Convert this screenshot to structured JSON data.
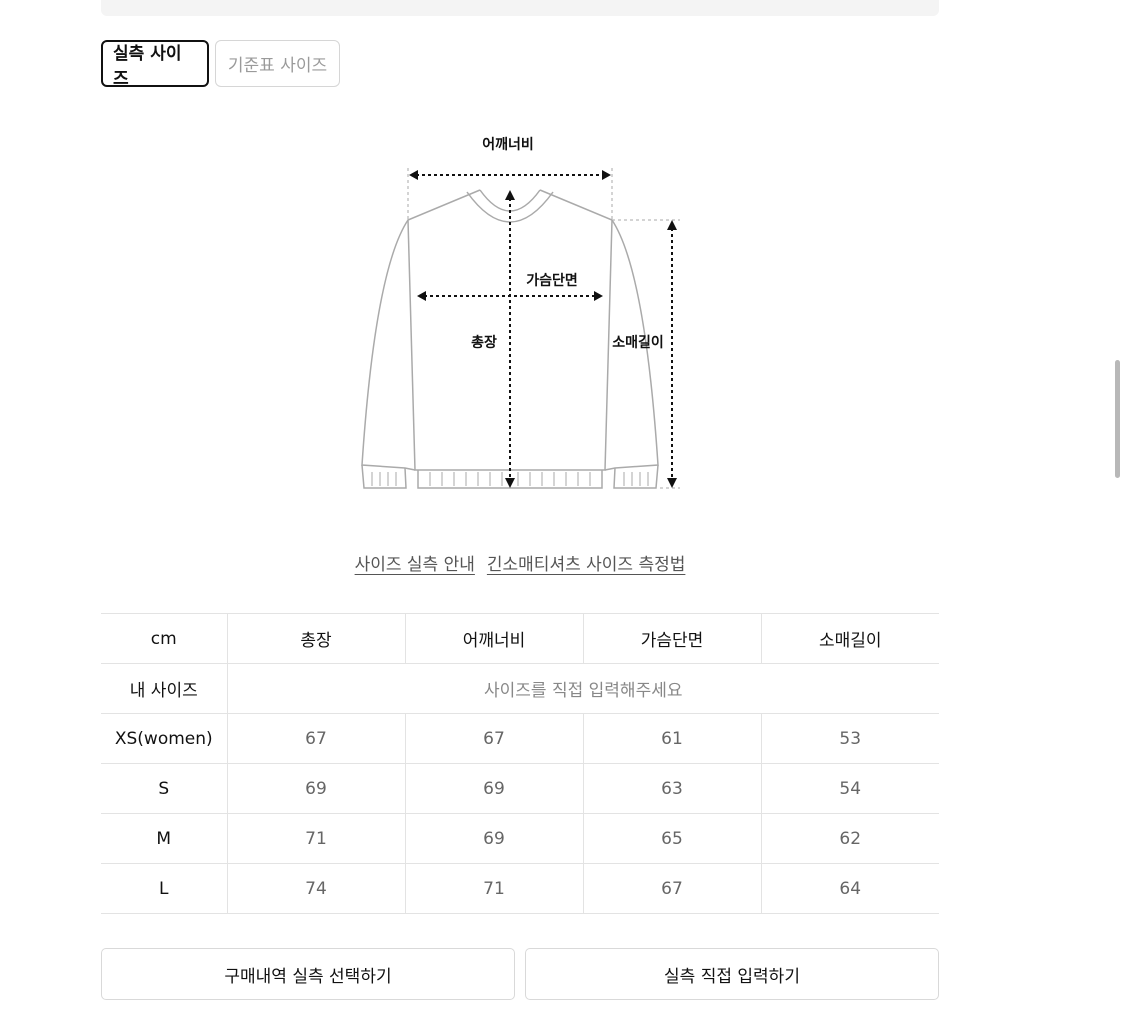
{
  "tabs": {
    "measured": "실측 사이즈",
    "standard": "기준표 사이즈"
  },
  "diagram": {
    "shoulder": "어깨너비",
    "chest": "가슴단면",
    "length": "총장",
    "sleeve": "소매길이"
  },
  "links": {
    "guide": "사이즈 실측 안내",
    "method": "긴소매티셔츠 사이즈 측정법"
  },
  "table": {
    "headers": [
      "cm",
      "총장",
      "어깨너비",
      "가슴단면",
      "소매길이"
    ],
    "my_size_label": "내 사이즈",
    "my_size_placeholder": "사이즈를 직접 입력해주세요",
    "rows": [
      {
        "size": "XS(women)",
        "values": [
          "67",
          "67",
          "61",
          "53"
        ]
      },
      {
        "size": "S",
        "values": [
          "69",
          "69",
          "63",
          "54"
        ]
      },
      {
        "size": "M",
        "values": [
          "71",
          "69",
          "65",
          "62"
        ]
      },
      {
        "size": "L",
        "values": [
          "74",
          "71",
          "67",
          "64"
        ]
      }
    ]
  },
  "actions": {
    "select_history": "구매내역 실측 선택하기",
    "enter_direct": "실측 직접 입력하기"
  }
}
